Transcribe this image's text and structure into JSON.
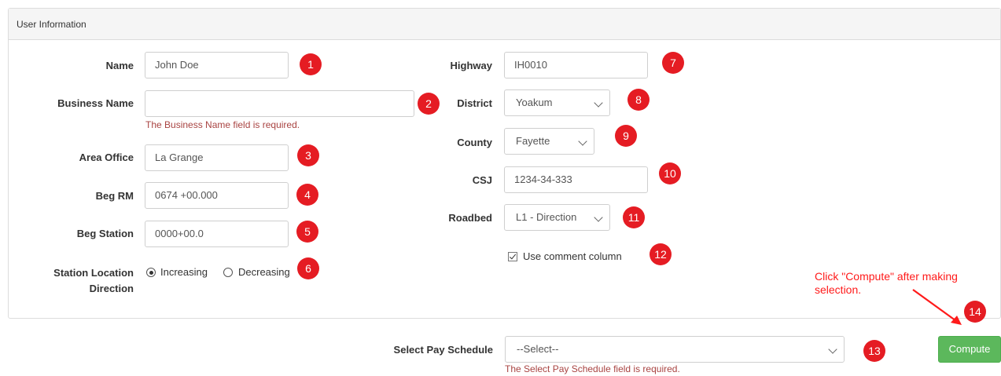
{
  "panel": {
    "title": "User Information"
  },
  "left": {
    "name": {
      "label": "Name",
      "value": "John Doe"
    },
    "business": {
      "label": "Business Name",
      "value": "",
      "error": "The Business Name field is required."
    },
    "area": {
      "label": "Area Office",
      "value": "La Grange"
    },
    "begrm": {
      "label": "Beg RM",
      "value": "0674 +00.000"
    },
    "begstation": {
      "label": "Beg Station",
      "value": "0000+00.0"
    },
    "direction": {
      "label_line1": "Station Location",
      "label_line2": "Direction",
      "option1": "Increasing",
      "option2": "Decreasing",
      "selected": "Increasing"
    }
  },
  "right": {
    "highway": {
      "label": "Highway",
      "value": "IH0010"
    },
    "district": {
      "label": "District",
      "value": "Yoakum"
    },
    "county": {
      "label": "County",
      "value": "Fayette"
    },
    "csj": {
      "label": "CSJ",
      "value": "1234-34-333"
    },
    "roadbed": {
      "label": "Roadbed",
      "value": "L1 - Direction"
    },
    "comment": {
      "label": "Use comment column",
      "checked": true
    }
  },
  "pay": {
    "label": "Select Pay Schedule",
    "value": "--Select--",
    "error": "The Select Pay Schedule field is required."
  },
  "compute": {
    "label": "Compute"
  },
  "annotation": {
    "line1": "Click \"Compute\" after making",
    "line2": "selection."
  },
  "badges": [
    "1",
    "2",
    "3",
    "4",
    "5",
    "6",
    "7",
    "8",
    "9",
    "10",
    "11",
    "12",
    "13",
    "14"
  ],
  "colors": {
    "badge": "#e51c23",
    "error": "#a94442",
    "compute": "#5cb85c",
    "annotation": "#ff1a1a"
  }
}
